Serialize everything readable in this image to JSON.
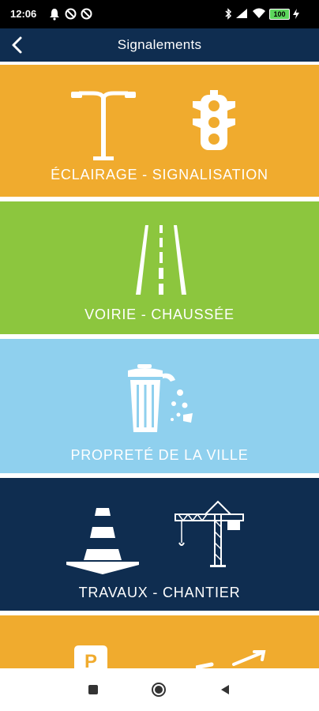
{
  "status_bar": {
    "time": "12:06",
    "battery": "100",
    "left_icons": [
      "bell-icon",
      "blocked-icon",
      "blocked-icon"
    ],
    "right_icons": [
      "bluetooth-icon",
      "signal-icon",
      "wifi-icon",
      "battery-icon",
      "charging-icon"
    ]
  },
  "header": {
    "title": "Signalements",
    "back_icon": "chevron-left-icon"
  },
  "categories": [
    {
      "label": "ÉCLAIRAGE - SIGNALISATION",
      "color": "#f0ab2e",
      "icons": [
        "streetlight-icon",
        "traffic-light-icon"
      ]
    },
    {
      "label": "VOIRIE - CHAUSSÉE",
      "color": "#8cc63e",
      "icons": [
        "road-icon"
      ]
    },
    {
      "label": "PROPRETÉ DE LA VILLE",
      "color": "#8fd0ee",
      "icons": [
        "trash-can-icon"
      ]
    },
    {
      "label": "TRAVAUX - CHANTIER",
      "color": "#0f2d50",
      "icons": [
        "traffic-cone-icon",
        "crane-icon"
      ]
    },
    {
      "label": "",
      "color": "#f0ab2e",
      "icons": [
        "parking-sign-icon",
        "arrow-icon"
      ]
    }
  ],
  "nav_bar": {
    "items": [
      "recent-apps-icon",
      "home-icon",
      "back-icon"
    ]
  }
}
